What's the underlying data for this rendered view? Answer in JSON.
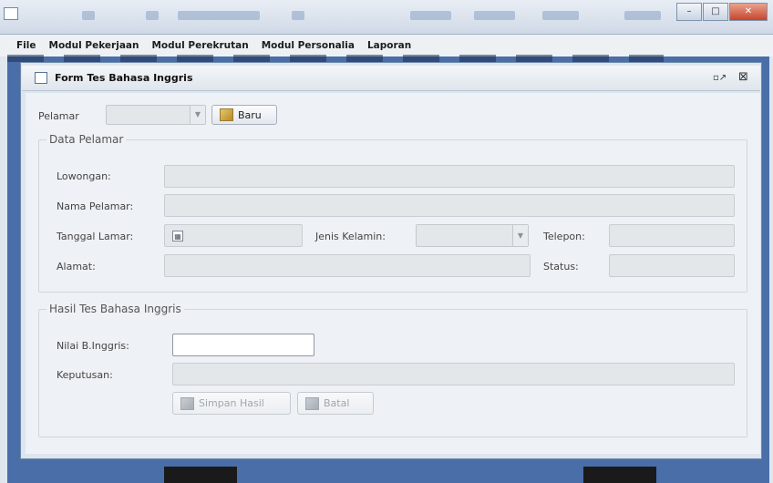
{
  "menu": [
    "File",
    "Modul Pekerjaan",
    "Modul Perekrutan",
    "Modul Personalia",
    "Laporan"
  ],
  "frame": {
    "title": "Form Tes Bahasa Inggris",
    "restore": "□↗",
    "close": "⊠"
  },
  "pelamar": {
    "label": "Pelamar",
    "value": "",
    "new_button": "Baru"
  },
  "data_pelamar": {
    "legend": "Data Pelamar",
    "lowongan_label": "Lowongan:",
    "nama_label": "Nama Pelamar:",
    "tanggal_label": "Tanggal Lamar:",
    "jenis_kelamin_label": "Jenis Kelamin:",
    "jenis_kelamin_value": "",
    "telepon_label": "Telepon:",
    "alamat_label": "Alamat:",
    "status_label": "Status:"
  },
  "hasil": {
    "legend": "Hasil Tes Bahasa Inggris",
    "nilai_label": "Nilai B.Inggris:",
    "keputusan_label": "Keputusan:",
    "save_button": "Simpan Hasil",
    "cancel_button": "Batal"
  }
}
